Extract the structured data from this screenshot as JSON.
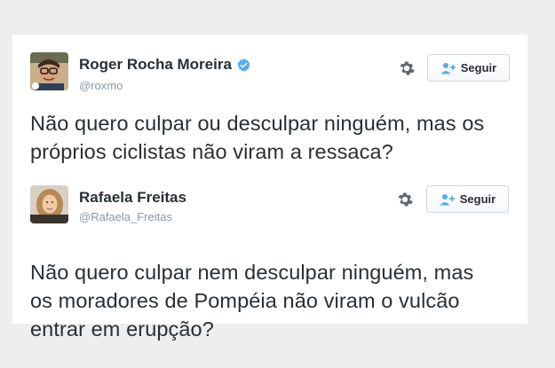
{
  "tweets": [
    {
      "name": "Roger Rocha Moreira",
      "handle": "@roxmo",
      "verified": true,
      "follow_label": "Seguir",
      "text_lines": [
        "Não quero culpar ou desculpar ninguém, mas os",
        "próprios ciclistas não viram a ressaca?"
      ]
    },
    {
      "name": "Rafaela Freitas",
      "handle": "@Rafaela_Freitas",
      "verified": false,
      "follow_label": "Seguir",
      "text_lines": [
        "Não quero culpar nem desculpar ninguém, mas",
        "os moradores de Pompéia não viram o vulcão",
        "entrar em erupção?"
      ]
    }
  ],
  "colors": {
    "accent": "#55acee",
    "text": "#292f33",
    "muted": "#8899a6",
    "page_background": "#eceef0"
  },
  "icons": [
    "verified-badge-icon",
    "gear-icon",
    "follow-user-icon"
  ]
}
